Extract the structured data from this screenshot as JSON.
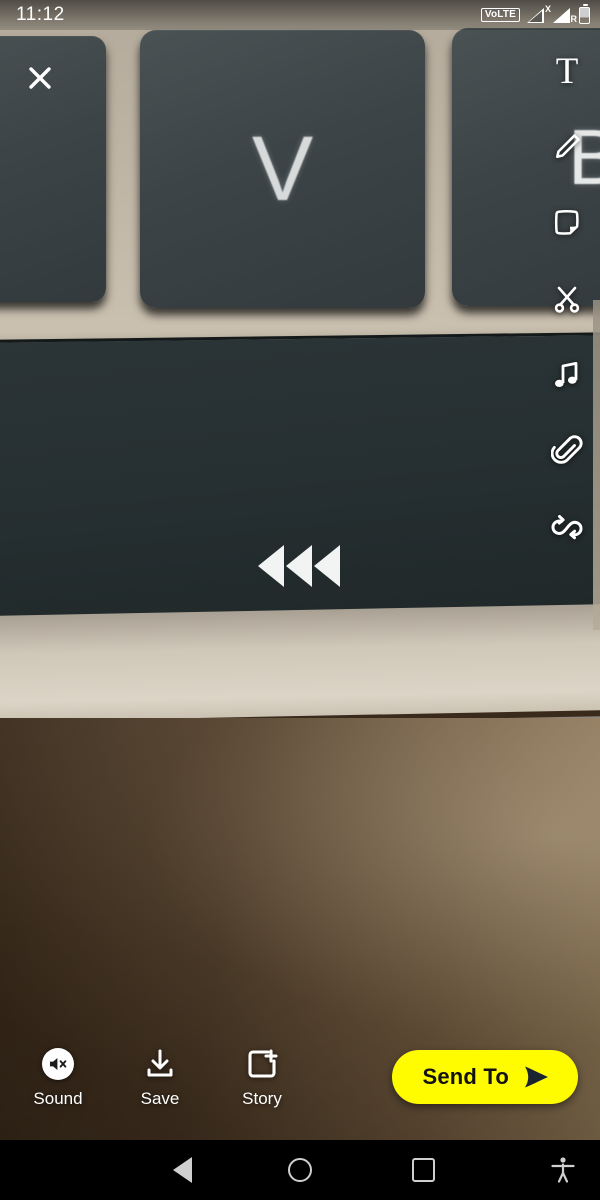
{
  "status_bar": {
    "clock": "11:12",
    "volte_badge": "VoLTE",
    "sim1_mark": "X",
    "sim2_mark": "R",
    "icons": [
      "volte-badge",
      "signal-x-icon",
      "signal-r-icon",
      "battery-icon"
    ]
  },
  "preview": {
    "close_label": "✕",
    "photo_description": "Close-up photograph of a laptop keyboard showing a V key, a partial B key and a dark slab with a triple rewind arrow marking, resting on a brown desk",
    "photo_text": {
      "key_v": "V",
      "key_b": "B",
      "rewind_marking": "◀◀◀"
    },
    "colors": {
      "deck_beige": "#c0b6a6",
      "key_dark": "#3c4447",
      "slab_dark": "#262f31",
      "table_brown": "#4a3724",
      "table_highlight": "#8d7655"
    }
  },
  "tool_rail": {
    "items": [
      {
        "name": "text-tool",
        "icon": "text-icon",
        "glyph": "T"
      },
      {
        "name": "draw-tool",
        "icon": "pencil-icon"
      },
      {
        "name": "sticker-tool",
        "icon": "sticker-icon"
      },
      {
        "name": "scissors-tool",
        "icon": "scissors-icon"
      },
      {
        "name": "music-tool",
        "icon": "music-note-icon"
      },
      {
        "name": "attach-link-tool",
        "icon": "paperclip-icon"
      },
      {
        "name": "loop-timer-tool",
        "icon": "loop-icon"
      }
    ]
  },
  "action_bar": {
    "actions": [
      {
        "label": "Sound",
        "icon": "speaker-muted-icon",
        "state": "muted"
      },
      {
        "label": "Save",
        "icon": "download-icon"
      },
      {
        "label": "Story",
        "icon": "add-to-story-icon"
      }
    ],
    "send_to": {
      "label": "Send To",
      "icon": "send-arrow-icon",
      "background": "#FFFC00",
      "text_color": "#121212"
    }
  },
  "nav_bar": {
    "buttons": [
      {
        "name": "back",
        "icon": "back-triangle-icon"
      },
      {
        "name": "home",
        "icon": "home-circle-icon"
      },
      {
        "name": "recents",
        "icon": "recents-square-icon"
      },
      {
        "name": "accessibility",
        "icon": "accessibility-person-icon"
      }
    ],
    "color": "#cfcfcf"
  }
}
